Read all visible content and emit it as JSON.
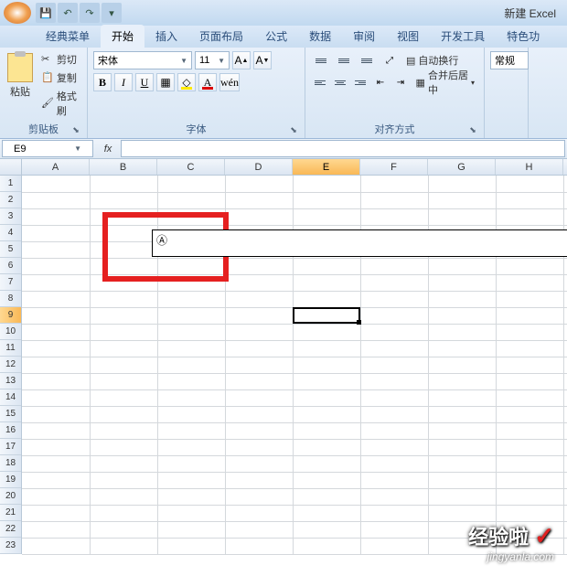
{
  "title": "新建 Excel",
  "qat": {
    "save": "💾",
    "undo": "↶",
    "redo": "↷"
  },
  "tabs": {
    "classic": "经典菜单",
    "home": "开始",
    "insert": "插入",
    "layout": "页面布局",
    "formulas": "公式",
    "data": "数据",
    "review": "审阅",
    "view": "视图",
    "developer": "开发工具",
    "special": "特色功"
  },
  "clipboard": {
    "paste": "粘贴",
    "cut": "剪切",
    "copy": "复制",
    "format_painter": "格式刷",
    "group_label": "剪贴板"
  },
  "font": {
    "name": "宋体",
    "size": "11",
    "grow": "A",
    "shrink": "A",
    "bold": "B",
    "italic": "I",
    "underline": "U",
    "group_label": "字体"
  },
  "alignment": {
    "wrap": "自动换行",
    "merge": "合并后居中",
    "group_label": "对齐方式"
  },
  "number": {
    "format": "常规"
  },
  "namebox": "E9",
  "columns": [
    "A",
    "B",
    "C",
    "D",
    "E",
    "F",
    "G",
    "H"
  ],
  "rows": [
    "1",
    "2",
    "3",
    "4",
    "5",
    "6",
    "7",
    "8",
    "9",
    "10",
    "11",
    "12",
    "13",
    "14",
    "15",
    "16",
    "17",
    "18",
    "19",
    "20",
    "21",
    "22",
    "23"
  ],
  "selected": {
    "col": "E",
    "row": "9"
  },
  "textbox_content": "Ⓐ",
  "watermark": {
    "main": "经验啦",
    "check": "✓",
    "sub": "jingyanla.com"
  }
}
